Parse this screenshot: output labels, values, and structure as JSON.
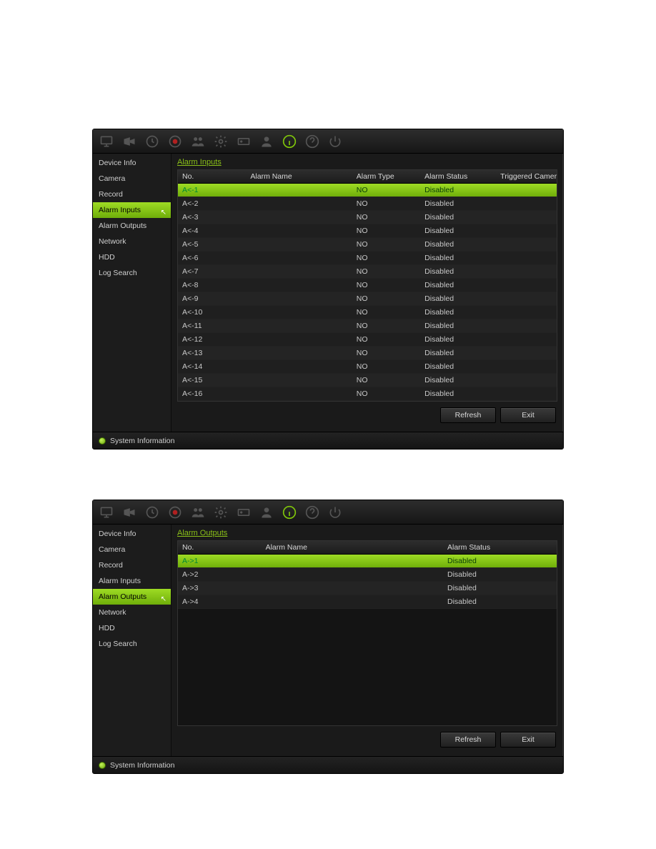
{
  "panels": [
    {
      "breadcrumb": "Alarm Inputs",
      "sidebar": {
        "items": [
          {
            "label": "Device Info"
          },
          {
            "label": "Camera"
          },
          {
            "label": "Record"
          },
          {
            "label": "Alarm Inputs",
            "selected": true
          },
          {
            "label": "Alarm Outputs"
          },
          {
            "label": "Network"
          },
          {
            "label": "HDD"
          },
          {
            "label": "Log Search"
          }
        ]
      },
      "columns": [
        "No.",
        "Alarm Name",
        "Alarm Type",
        "Alarm Status",
        "Triggered Camera"
      ],
      "rows": [
        {
          "no": "A<-1",
          "name": "",
          "type": "NO",
          "status": "Disabled",
          "cam": "",
          "selected": true
        },
        {
          "no": "A<-2",
          "name": "",
          "type": "NO",
          "status": "Disabled",
          "cam": ""
        },
        {
          "no": "A<-3",
          "name": "",
          "type": "NO",
          "status": "Disabled",
          "cam": ""
        },
        {
          "no": "A<-4",
          "name": "",
          "type": "NO",
          "status": "Disabled",
          "cam": ""
        },
        {
          "no": "A<-5",
          "name": "",
          "type": "NO",
          "status": "Disabled",
          "cam": ""
        },
        {
          "no": "A<-6",
          "name": "",
          "type": "NO",
          "status": "Disabled",
          "cam": ""
        },
        {
          "no": "A<-7",
          "name": "",
          "type": "NO",
          "status": "Disabled",
          "cam": ""
        },
        {
          "no": "A<-8",
          "name": "",
          "type": "NO",
          "status": "Disabled",
          "cam": ""
        },
        {
          "no": "A<-9",
          "name": "",
          "type": "NO",
          "status": "Disabled",
          "cam": ""
        },
        {
          "no": "A<-10",
          "name": "",
          "type": "NO",
          "status": "Disabled",
          "cam": ""
        },
        {
          "no": "A<-11",
          "name": "",
          "type": "NO",
          "status": "Disabled",
          "cam": ""
        },
        {
          "no": "A<-12",
          "name": "",
          "type": "NO",
          "status": "Disabled",
          "cam": ""
        },
        {
          "no": "A<-13",
          "name": "",
          "type": "NO",
          "status": "Disabled",
          "cam": ""
        },
        {
          "no": "A<-14",
          "name": "",
          "type": "NO",
          "status": "Disabled",
          "cam": ""
        },
        {
          "no": "A<-15",
          "name": "",
          "type": "NO",
          "status": "Disabled",
          "cam": ""
        },
        {
          "no": "A<-16",
          "name": "",
          "type": "NO",
          "status": "Disabled",
          "cam": ""
        }
      ],
      "buttons": {
        "refresh": "Refresh",
        "exit": "Exit"
      },
      "footer": "System Information"
    },
    {
      "breadcrumb": "Alarm Outputs",
      "sidebar": {
        "items": [
          {
            "label": "Device Info"
          },
          {
            "label": "Camera"
          },
          {
            "label": "Record"
          },
          {
            "label": "Alarm Inputs"
          },
          {
            "label": "Alarm Outputs",
            "selected": true
          },
          {
            "label": "Network"
          },
          {
            "label": "HDD"
          },
          {
            "label": "Log Search"
          }
        ]
      },
      "columns": [
        "No.",
        "Alarm Name",
        "Alarm Status"
      ],
      "rows": [
        {
          "no": "A->1",
          "name": "",
          "status": "Disabled",
          "selected": true
        },
        {
          "no": "A->2",
          "name": "",
          "status": "Disabled"
        },
        {
          "no": "A->3",
          "name": "",
          "status": "Disabled"
        },
        {
          "no": "A->4",
          "name": "",
          "status": "Disabled"
        }
      ],
      "buttons": {
        "refresh": "Refresh",
        "exit": "Exit"
      },
      "footer": "System Information"
    }
  ],
  "toolbar_icons": [
    "monitor-icon",
    "camera-icon",
    "clock-icon",
    "record-icon",
    "people-icon",
    "gear-icon",
    "hdd-icon",
    "user-icon",
    "info-icon",
    "help-icon",
    "power-icon"
  ]
}
